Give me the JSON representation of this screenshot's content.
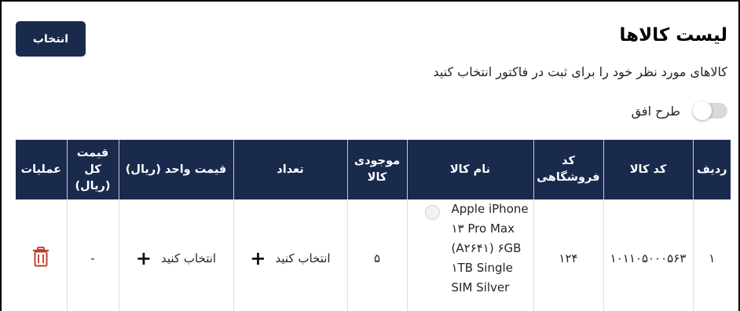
{
  "header": {
    "title": "لیست کالاها",
    "subtitle": "کالاهای مورد نظر خود را برای ثبت در فاکتور انتخاب کنید",
    "select_button": "انتخاب",
    "toggle_label": "طرح افق"
  },
  "table": {
    "columns": [
      {
        "line1": "ردیف",
        "line2": "",
        "line3": ""
      },
      {
        "line1": "کد کالا",
        "line2": "",
        "line3": ""
      },
      {
        "line1": "کد",
        "line2": "فروشگاهی",
        "line3": ""
      },
      {
        "line1": "نام کالا",
        "line2": "",
        "line3": ""
      },
      {
        "line1": "موجودی",
        "line2": "کالا",
        "line3": ""
      },
      {
        "line1": "تعداد",
        "line2": "",
        "line3": ""
      },
      {
        "line1": "قیمت واحد (ریال)",
        "line2": "",
        "line3": ""
      },
      {
        "line1": "قیمت",
        "line2": "کل",
        "line3": "(ریال)"
      },
      {
        "line1": "عملیات",
        "line2": "",
        "line3": ""
      }
    ],
    "rows": [
      {
        "index": "۱",
        "code": "۱۰۱۱۰۵۰۰۰۵۶۳",
        "store_code": "۱۲۴",
        "name": "Apple iPhone ۱۳ Pro Max (A۲۶۴۱) ۶GB ۱TB Single SIM Silver",
        "stock": "۵",
        "quantity": "انتخاب کنید",
        "unit_price": "انتخاب کنید",
        "total_price": "-"
      }
    ]
  },
  "icons": {
    "add_quantity": "plus-icon",
    "add_price": "plus-icon",
    "delete": "trash-icon"
  },
  "colors": {
    "header_bg": "#1a2a4d",
    "delete_icon": "#c0392b"
  }
}
